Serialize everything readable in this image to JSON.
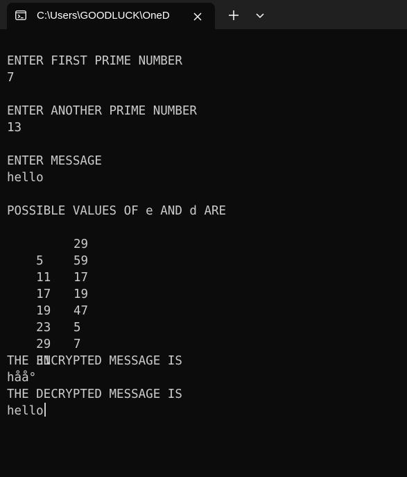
{
  "window": {
    "tab_title": "C:\\Users\\GOODLUCK\\OneD",
    "tab_icon": "terminal-icon",
    "close_icon": "close-icon",
    "new_tab_icon": "plus-icon",
    "dropdown_icon": "chevron-down-icon"
  },
  "console": {
    "prompt_first_prime": "ENTER FIRST PRIME NUMBER",
    "first_prime": "7",
    "prompt_second_prime": "ENTER ANOTHER PRIME NUMBER",
    "second_prime": "13",
    "prompt_message": "ENTER MESSAGE",
    "message": "hello",
    "pairs_heading": "POSSIBLE VALUES OF e AND d ARE",
    "pairs": [
      {
        "e": "5",
        "d": "29"
      },
      {
        "e": "11",
        "d": "59"
      },
      {
        "e": "17",
        "d": "17"
      },
      {
        "e": "19",
        "d": "19"
      },
      {
        "e": "23",
        "d": "47"
      },
      {
        "e": "29",
        "d": "5"
      },
      {
        "e": "31",
        "d": "7"
      }
    ],
    "encrypted_heading": "THE ENCRYPTED MESSAGE IS",
    "encrypted_message": "håå°",
    "decrypted_heading": "THE DECRYPTED MESSAGE IS",
    "decrypted_message": "hello"
  },
  "colors": {
    "background": "#0c0c0c",
    "titlebar": "#202020",
    "text": "#cccccc"
  }
}
